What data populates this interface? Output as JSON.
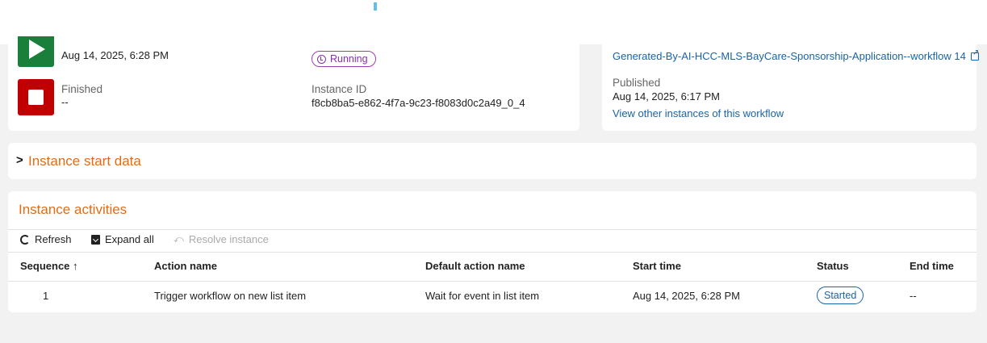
{
  "summary": {
    "started_time": "Aug 14, 2025, 6:28 PM",
    "finished_label": "Finished",
    "finished_value": "--",
    "status": "Running",
    "instance_id_label": "Instance ID",
    "instance_id": "f8cb8ba5-e862-4f7a-9c23-f8083d0c2a49_0_4"
  },
  "workflow": {
    "name": "Generated-By-AI-HCC-MLS-BayCare-Sponsorship-Application--workflow 14",
    "published_label": "Published",
    "published_time": "Aug 14, 2025, 6:17 PM",
    "other_instances_link": "View other instances of this workflow"
  },
  "start_data": {
    "title": "Instance start data",
    "chevron": ">"
  },
  "activities": {
    "title": "Instance activities",
    "toolbar": {
      "refresh": "Refresh",
      "expand_all": "Expand all",
      "resolve": "Resolve instance"
    },
    "columns": [
      "Sequence ↑",
      "Action name",
      "Default action name",
      "Start time",
      "Status",
      "End time"
    ],
    "rows": [
      {
        "sequence": "1",
        "action_name": "Trigger workflow on new list item",
        "default_action_name": "Wait for event in list item",
        "start_time": "Aug 14, 2025, 6:28 PM",
        "status": "Started",
        "end_time": "--"
      }
    ]
  },
  "colors": {
    "accent_orange": "#e06c17",
    "link_blue": "#1a63a6",
    "running_purple": "#8a2fa8",
    "start_green": "#1a7f3a",
    "finish_red": "#c00000"
  }
}
